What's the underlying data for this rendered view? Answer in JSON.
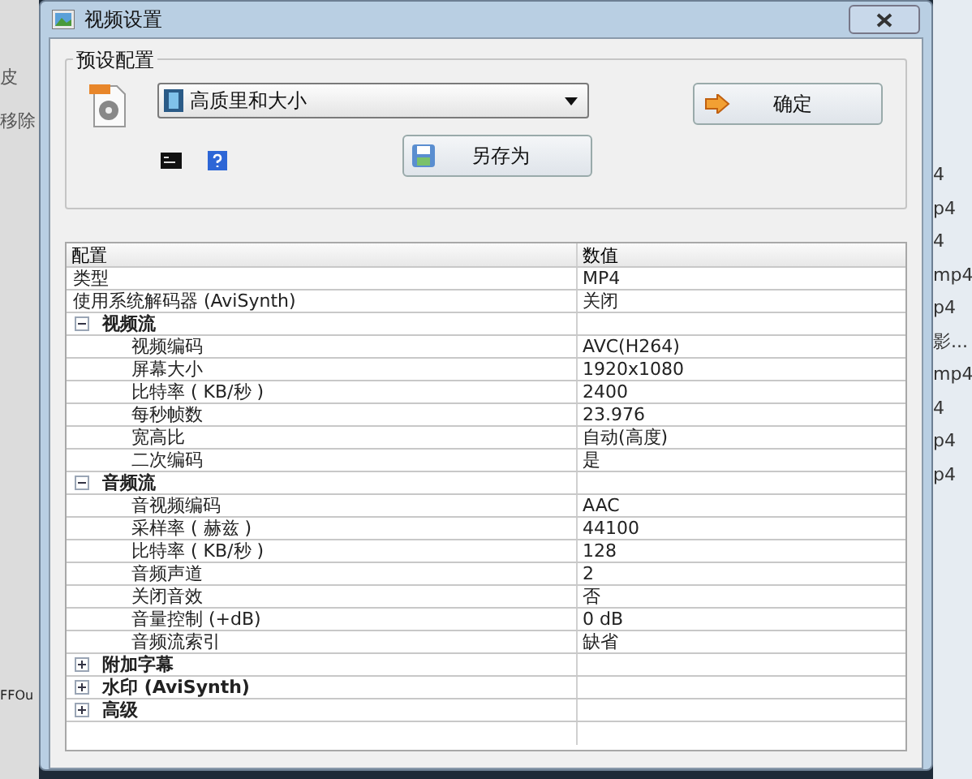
{
  "background": {
    "left_items": [
      "皮",
      "移除",
      "FFOu"
    ],
    "right_items": [
      "4",
      "p4",
      "4",
      "mp4",
      "p4",
      "影...",
      "mp4",
      "4",
      "p4",
      "p4"
    ]
  },
  "window": {
    "title": "视频设置"
  },
  "preset": {
    "group_label": "预设配置",
    "dropdown_value": "高质里和大小",
    "ok_button": "确定",
    "save_as_button": "另存为"
  },
  "table": {
    "columns": [
      "配置",
      "数值"
    ],
    "rows": [
      {
        "kind": "row",
        "name": "类型",
        "value": "MP4"
      },
      {
        "kind": "row",
        "name": "使用系统解码器 (AviSynth)",
        "value": "关闭"
      },
      {
        "kind": "group",
        "name": "视频流",
        "expanded": true,
        "children": [
          {
            "name": "视频编码",
            "value": "AVC(H264)"
          },
          {
            "name": "屏幕大小",
            "value": "1920x1080"
          },
          {
            "name": "比特率 ( KB/秒 )",
            "value": "2400"
          },
          {
            "name": "每秒帧数",
            "value": "23.976"
          },
          {
            "name": "宽高比",
            "value": "自动(高度)"
          },
          {
            "name": "二次编码",
            "value": "是"
          }
        ]
      },
      {
        "kind": "group",
        "name": "音频流",
        "expanded": true,
        "children": [
          {
            "name": "音视频编码",
            "value": "AAC"
          },
          {
            "name": "采样率 ( 赫兹 )",
            "value": "44100"
          },
          {
            "name": "比特率 ( KB/秒 )",
            "value": "128"
          },
          {
            "name": "音频声道",
            "value": "2"
          },
          {
            "name": "关闭音效",
            "value": "否"
          },
          {
            "name": "音量控制 (+dB)",
            "value": "0 dB"
          },
          {
            "name": "音频流索引",
            "value": "缺省"
          }
        ]
      },
      {
        "kind": "group",
        "name": "附加字幕",
        "expanded": false,
        "children": []
      },
      {
        "kind": "group",
        "name": "水印 (AviSynth)",
        "expanded": false,
        "children": []
      },
      {
        "kind": "group",
        "name": "高级",
        "expanded": false,
        "children": []
      }
    ]
  }
}
